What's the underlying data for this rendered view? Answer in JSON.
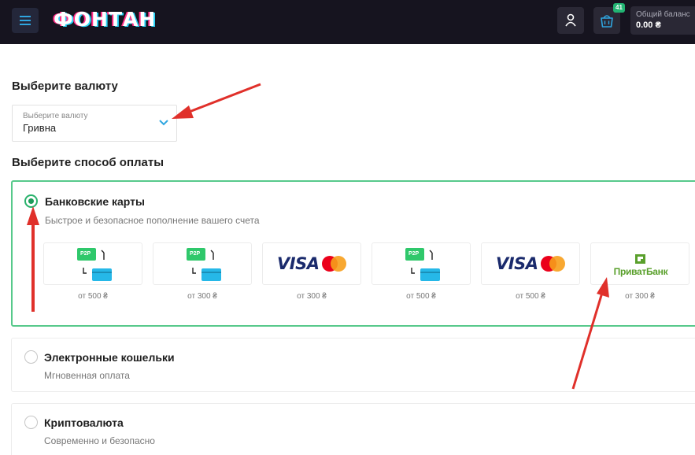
{
  "header": {
    "logo_text": "ФОНТАН",
    "basket_badge": "41",
    "balance_label": "Общий баланс",
    "balance_value": "0.00 ₴",
    "menu_icon": "hamburger-icon",
    "user_icon": "user-icon",
    "basket_icon": "basket-icon"
  },
  "currency": {
    "section_title": "Выберите валюту",
    "select_label": "Выберите валюту",
    "select_value": "Гривна"
  },
  "payment": {
    "section_title": "Выберите способ оплаты",
    "options": [
      {
        "title": "Банковские карты",
        "subtitle": "Быстрое и безопасное пополнение вашего счета",
        "selected": true,
        "methods": [
          {
            "kind": "p2p",
            "p2p_label": "P2P",
            "min": "от 500 ₴"
          },
          {
            "kind": "p2p",
            "p2p_label": "P2P",
            "min": "от 300 ₴"
          },
          {
            "kind": "visa-mastercard",
            "visa_label": "VISA",
            "min": "от 300 ₴"
          },
          {
            "kind": "p2p",
            "p2p_label": "P2P",
            "min": "от 500 ₴"
          },
          {
            "kind": "visa-mastercard",
            "visa_label": "VISA",
            "min": "от 500 ₴"
          },
          {
            "kind": "privatbank",
            "bank_label": "ПриватБанк",
            "min": "от 300 ₴"
          }
        ]
      },
      {
        "title": "Электронные кошельки",
        "subtitle": "Мгновенная оплата",
        "selected": false
      },
      {
        "title": "Криптовалюта",
        "subtitle": "Современно и безопасно",
        "selected": false
      }
    ]
  },
  "colors": {
    "header_bg": "#16141f",
    "accent_green": "#28b26b",
    "annotation_red": "#e0302a",
    "p2p_green": "#2fc86b",
    "card_cyan": "#26b8e8",
    "privat_green": "#5aa02c"
  }
}
